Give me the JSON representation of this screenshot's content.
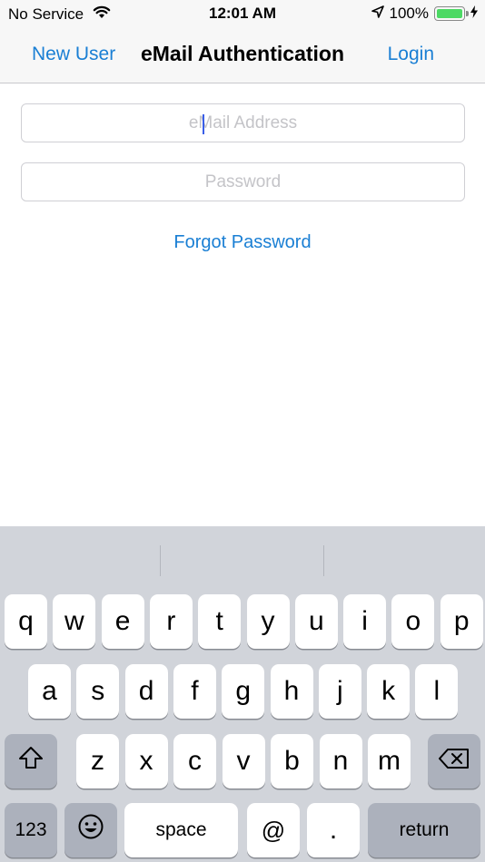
{
  "status_bar": {
    "carrier": "No Service",
    "time": "12:01 AM",
    "battery_percent": "100%",
    "battery_level": 1.0,
    "battery_color": "#4cd964",
    "wifi_icon": "wifi-icon",
    "location_icon": "location-arrow-icon",
    "charging_icon": "bolt-icon"
  },
  "nav_bar": {
    "left_button": "New User",
    "title": "eMail Authentication",
    "right_button": "Login",
    "accent_color": "#1a7fd4"
  },
  "form": {
    "email": {
      "value": "",
      "placeholder": "eMail Address"
    },
    "password": {
      "value": "",
      "placeholder": "Password"
    },
    "forgot_password": "Forgot Password"
  },
  "keyboard": {
    "row1": [
      "q",
      "w",
      "e",
      "r",
      "t",
      "y",
      "u",
      "i",
      "o",
      "p"
    ],
    "row2": [
      "a",
      "s",
      "d",
      "f",
      "g",
      "h",
      "j",
      "k",
      "l"
    ],
    "row3": [
      "z",
      "x",
      "c",
      "v",
      "b",
      "n",
      "m"
    ],
    "shift_icon": "shift-icon",
    "delete_icon": "delete-backward-icon",
    "numbers_key": "123",
    "emoji_icon": "emoji-icon",
    "space_key": "space",
    "at_key": "@",
    "period_key": ".",
    "return_key": "return"
  }
}
